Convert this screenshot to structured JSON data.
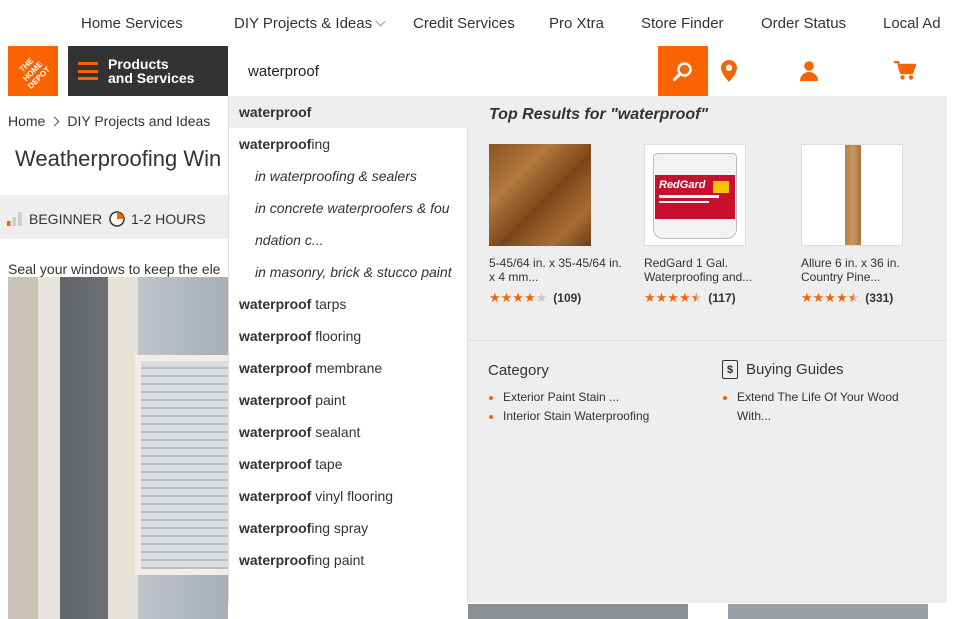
{
  "topnav": {
    "items": [
      "Home Services",
      "DIY Projects & Ideas",
      "Credit Services",
      "Pro Xtra",
      "Store Finder",
      "Order Status",
      "Local Ad"
    ]
  },
  "header": {
    "products_label_line1": "Products",
    "products_label_line2": "and Services",
    "search_value": "waterproof"
  },
  "page": {
    "breadcrumb": [
      "Home",
      "DIY Projects and Ideas"
    ],
    "title": "Weatherproofing Win",
    "level": "BEGINNER",
    "duration": "1-2 HOURS",
    "intro": "Seal your windows to keep the ele"
  },
  "suggestions": [
    {
      "type": "head",
      "bold": "waterproof",
      "rest": ""
    },
    {
      "type": "term",
      "bold": "waterproof",
      "rest": "ing"
    },
    {
      "type": "sub",
      "text": "in waterproofing & sealers"
    },
    {
      "type": "sub",
      "text": "in concrete waterproofers & fou"
    },
    {
      "type": "sub",
      "text": "ndation c..."
    },
    {
      "type": "sub",
      "text": "in masonry, brick & stucco paint"
    },
    {
      "type": "term",
      "bold": "waterproof",
      "rest": " tarps"
    },
    {
      "type": "term",
      "bold": "waterproof",
      "rest": " flooring"
    },
    {
      "type": "term",
      "bold": "waterproof",
      "rest": " membrane"
    },
    {
      "type": "term",
      "bold": "waterproof",
      "rest": " paint"
    },
    {
      "type": "term",
      "bold": "waterproof",
      "rest": " sealant"
    },
    {
      "type": "term",
      "bold": "waterproof",
      "rest": " tape"
    },
    {
      "type": "term",
      "bold": "waterproof",
      "rest": " vinyl flooring"
    },
    {
      "type": "term",
      "bold": "waterproof",
      "rest": "ing spray"
    },
    {
      "type": "term",
      "bold": "waterproof",
      "rest": "ing paint"
    }
  ],
  "results": {
    "title": "Top Results for \"waterproof\"",
    "products": [
      {
        "name_line1": "5-45/64 in. x 35-45/64 in.",
        "name_line2": "x 4 mm...",
        "rating": 4,
        "reviews": "(109)",
        "image": "wood-floor-plank"
      },
      {
        "name_line1": "RedGard 1 Gal.",
        "name_line2": "Waterproofing and...",
        "rating": 4.5,
        "reviews": "(117)",
        "image": "redgard-bucket",
        "bucket_label": "RedGard"
      },
      {
        "name_line1": "Allure 6 in. x 36 in.",
        "name_line2": "Country Pine...",
        "rating": 4.5,
        "reviews": "(331)",
        "image": "vinyl-plank"
      }
    ],
    "category_heading": "Category",
    "categories": [
      "Exterior Paint Stain ...",
      "Interior Stain Waterproofing"
    ],
    "guides_heading": "Buying Guides",
    "guides": [
      "Extend The Life Of Your Wood",
      "With..."
    ]
  },
  "colors": {
    "brand_orange": "#f96302",
    "dark_bar": "#333333",
    "panel_gray": "#eeeeee"
  },
  "icons": {
    "search": "search-icon",
    "location": "location-pin-icon",
    "account": "user-icon",
    "cart": "cart-icon"
  }
}
